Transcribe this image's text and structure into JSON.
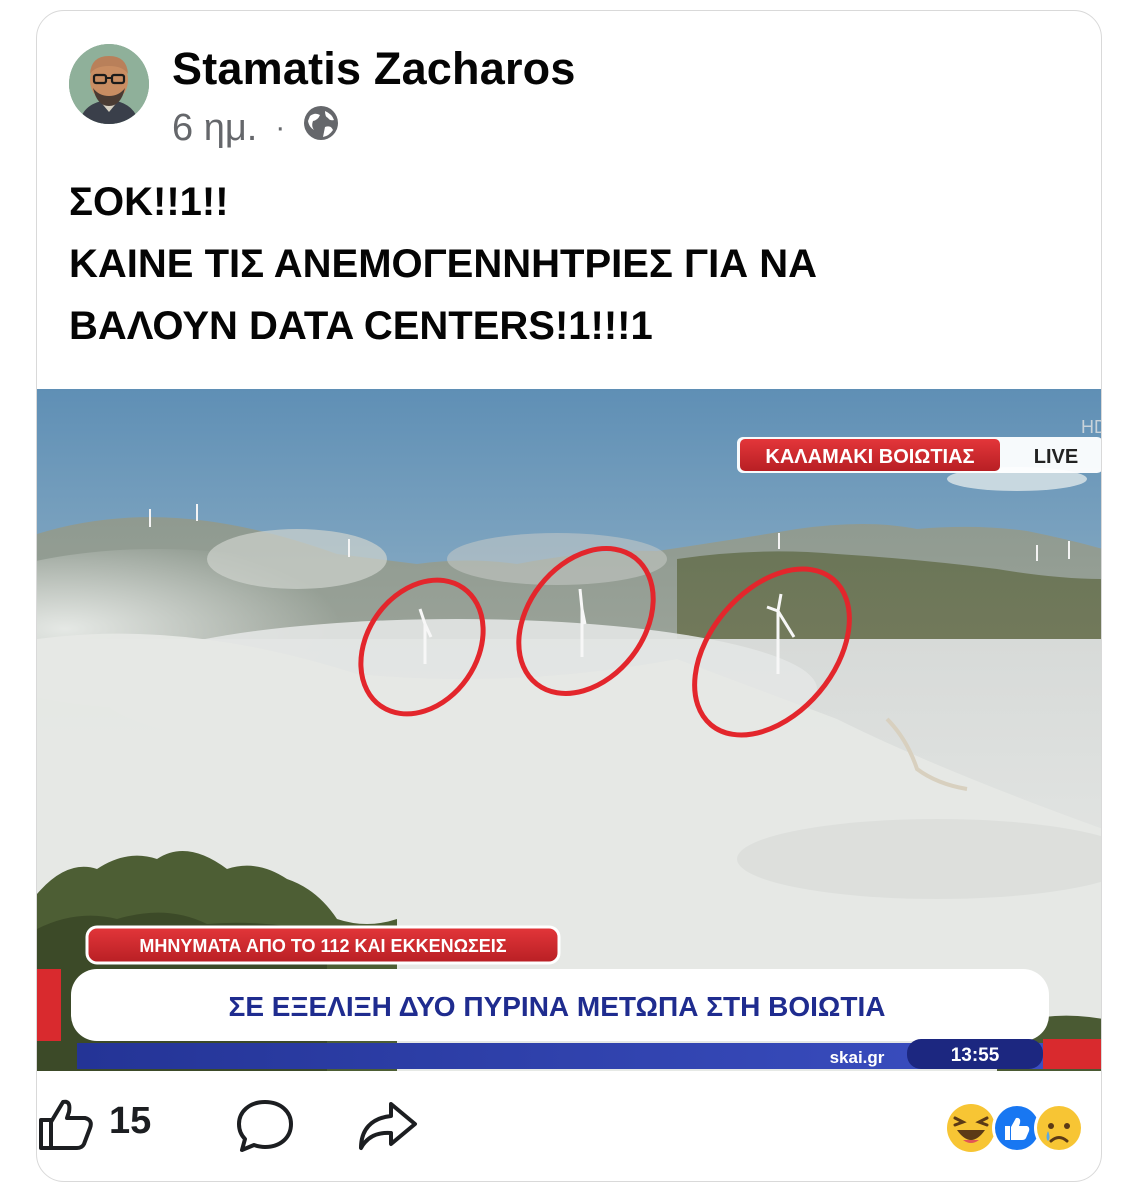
{
  "post": {
    "author": "Stamatis Zacharos",
    "time": "6 ημ.",
    "separator": "·",
    "visibility_icon": "globe-icon",
    "text_lines": [
      "ΣΟΚ!!1!!",
      "ΚΑΙΝΕ ΤΙΣ ΑΝΕΜΟΓΕΝΝΗΤΡΙΕΣ ΓΙΑ ΝΑ",
      "ΒΑΛΟΥΝ DATA CENTERS!1!!!1"
    ]
  },
  "broadcast": {
    "location": "ΚΑΛΑΜΑΚΙ ΒΟΙΩΤΙΑΣ",
    "live_label": "LIVE",
    "hd_label": "HD",
    "alert": "ΜΗΝΥΜΑΤΑ ΑΠΟ ΤΟ 112 ΚΑΙ ΕΚΚΕΝΩΣΕΙΣ",
    "headline": "ΣΕ ΕΞΕΛΙΞΗ ΔΥΟ ΠΥΡΙΝΑ ΜΕΤΩΠΑ ΣΤΗ ΒΟΙΩΤΙΑ",
    "channel": "skai.gr",
    "clock": "13:55",
    "colors": {
      "red": "#d92a2e",
      "blue": "#2a3a9c",
      "circle": "#e3262c"
    }
  },
  "actions": {
    "like_icon": "thumbs-up-icon",
    "like_count": "15",
    "comment_icon": "comment-icon",
    "share_icon": "share-icon",
    "reactions": [
      "haha-reaction-icon",
      "like-reaction-icon",
      "sad-reaction-icon"
    ]
  },
  "colors": {
    "meta_gray": "#65676b",
    "text": "#050505",
    "like_blue": "#1877f2"
  }
}
